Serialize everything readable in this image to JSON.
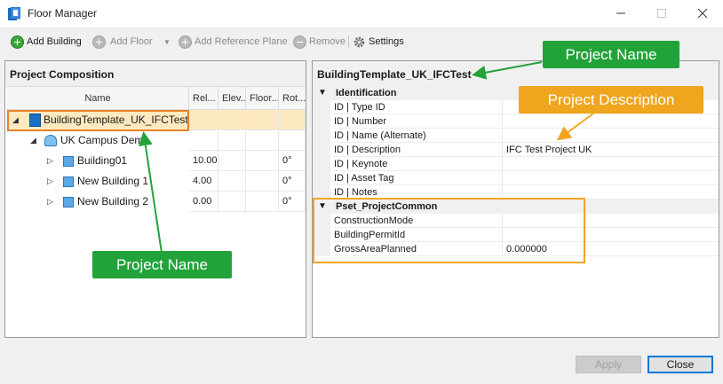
{
  "window": {
    "title": "Floor Manager",
    "icon": "revit-app-icon"
  },
  "toolbar": {
    "add_building": "Add Building",
    "add_floor": "Add Floor",
    "add_reference_plane": "Add Reference Plane",
    "remove": "Remove",
    "settings": "Settings"
  },
  "left_panel": {
    "header": "Project Composition",
    "columns": [
      "Name",
      "Rel...",
      "Elev...",
      "Floor...",
      "Rot..."
    ],
    "rows": [
      {
        "name": "BuildingTemplate_UK_IFCTest",
        "rel": "",
        "elev": "",
        "floor": "",
        "rot": "",
        "level": 0,
        "expander": "◢",
        "icon": "project-icon",
        "selected": true
      },
      {
        "name": "UK Campus Demo",
        "rel": "",
        "elev": "",
        "floor": "",
        "rot": "",
        "level": 1,
        "expander": "◢",
        "icon": "site-icon",
        "selected": false
      },
      {
        "name": "Building01",
        "rel": "10.00",
        "elev": "",
        "floor": "",
        "rot": "0°",
        "level": 2,
        "expander": "▷",
        "icon": "building-icon",
        "selected": false
      },
      {
        "name": "New Building 1",
        "rel": "4.00",
        "elev": "",
        "floor": "",
        "rot": "0°",
        "level": 2,
        "expander": "▷",
        "icon": "building-icon",
        "selected": false
      },
      {
        "name": "New Building 2",
        "rel": "0.00",
        "elev": "",
        "floor": "",
        "rot": "0°",
        "level": 2,
        "expander": "▷",
        "icon": "building-icon",
        "selected": false
      }
    ]
  },
  "right_panel": {
    "header": "BuildingTemplate_UK_IFCTest",
    "categories": [
      {
        "label": "Identification",
        "properties": [
          {
            "name": "ID | Type ID",
            "value": ""
          },
          {
            "name": "ID | Number",
            "value": ""
          },
          {
            "name": "ID | Name (Alternate)",
            "value": ""
          },
          {
            "name": "ID | Description",
            "value": "IFC Test Project UK"
          },
          {
            "name": "ID | Keynote",
            "value": ""
          },
          {
            "name": "ID | Asset Tag",
            "value": ""
          },
          {
            "name": "ID | Notes",
            "value": ""
          }
        ]
      },
      {
        "label": "Pset_ProjectCommon",
        "properties": [
          {
            "name": "ConstructionMode",
            "value": ""
          },
          {
            "name": "BuildingPermitId",
            "value": ""
          },
          {
            "name": "GrossAreaPlanned",
            "value": "0.000000"
          }
        ]
      }
    ]
  },
  "annotations": {
    "project_name_top": "Project Name",
    "project_description": "Project Description",
    "project_name_bottom": "Project Name"
  },
  "footer": {
    "apply": "Apply",
    "close": "Close"
  },
  "colors": {
    "selection": "#fde9bf",
    "selection_border": "#e8822a",
    "callout_green": "#22a33a",
    "callout_orange": "#f0a51f",
    "accent_blue": "#0078d7"
  }
}
